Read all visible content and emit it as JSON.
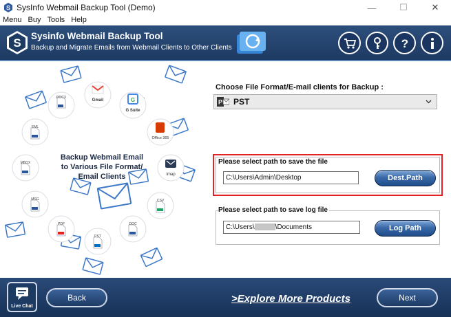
{
  "window": {
    "title": "SysInfo Webmail Backup Tool (Demo)",
    "minimize": "—",
    "maximize": "☐",
    "close": "✕"
  },
  "menu": [
    "Menu",
    "Buy",
    "Tools",
    "Help"
  ],
  "header": {
    "title": "Sysinfo Webmail Backup Tool",
    "subtitle": "Backup and Migrate Emails from Webmail Clients to Other Clients",
    "icons": [
      "cart-icon",
      "key-icon",
      "help-icon",
      "info-icon"
    ]
  },
  "illustration": {
    "text_lines": [
      "Backup Webmail Email",
      "to Various File Format/",
      "Email Clients"
    ],
    "items": [
      "DOCX",
      "Gmail",
      "G Suite",
      "Office 365",
      "EML",
      "MBOX",
      "Imap",
      "MSG",
      "CSV",
      "PDF",
      "PST",
      "DOC"
    ]
  },
  "format": {
    "label": "Choose File Format/E-mail clients for Backup :",
    "selected": "PST"
  },
  "dest": {
    "label": "Please select path to save the file",
    "path": "C:\\Users\\Admin\\Desktop",
    "button": "Dest.Path"
  },
  "log": {
    "label": "Please select path to save log file",
    "path_prefix": "C:\\Users\\",
    "path_suffix": "\\Documents",
    "button": "Log Path"
  },
  "footer": {
    "live_chat": "Live Chat",
    "back": "Back",
    "explore": ">Explore More Products",
    "next": "Next"
  },
  "colors": {
    "header_bg": "#1d3a62",
    "highlight_border": "#e32227",
    "button_blue": "#3a6aa8"
  }
}
